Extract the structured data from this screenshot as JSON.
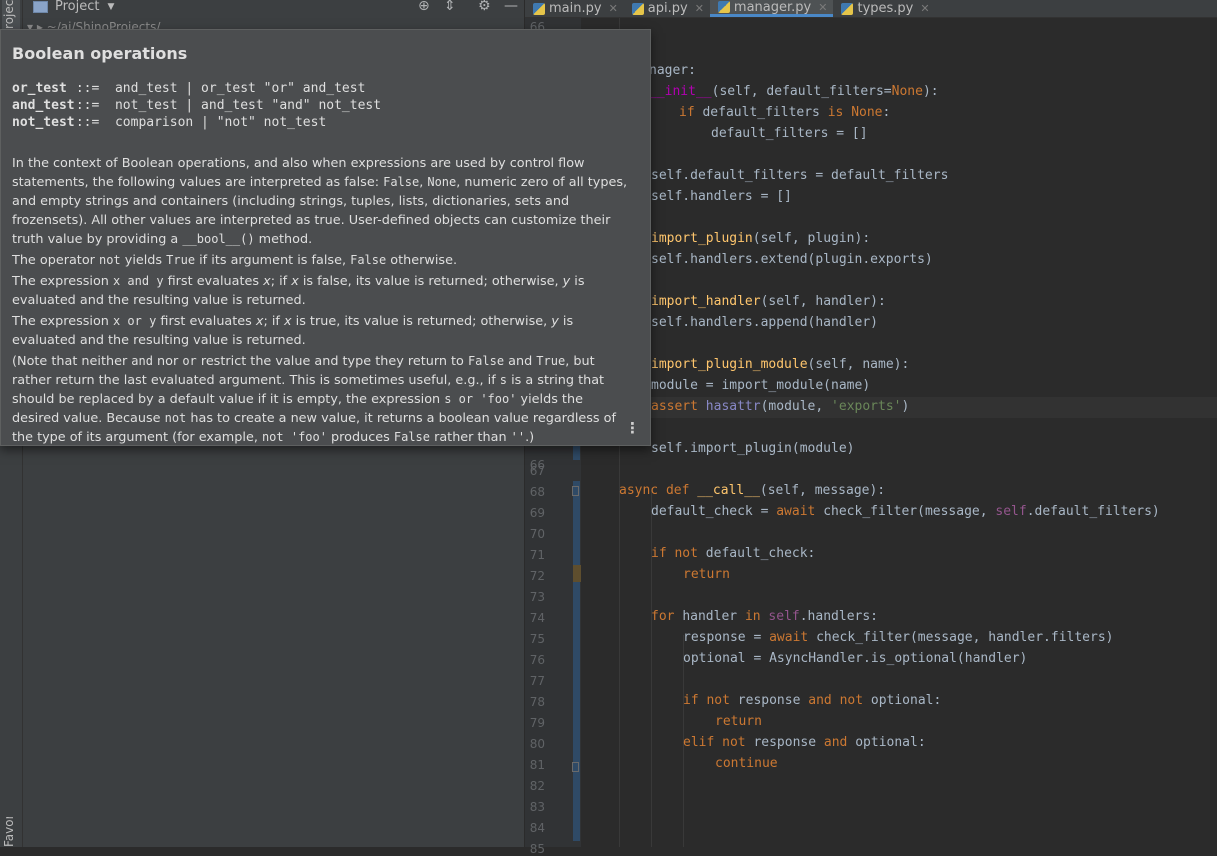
{
  "left_strip": {
    "project_tab": "Project",
    "favorites_tab": "Favorites"
  },
  "project_panel": {
    "title": "Project",
    "tree_row_text": "▾ ▸  ~/ai/ShinoProjects/..."
  },
  "editor_tabs": [
    {
      "label": "main.py",
      "active": false
    },
    {
      "label": "api.py",
      "active": false
    },
    {
      "label": "manager.py",
      "active": true
    },
    {
      "label": "types.py",
      "active": false
    }
  ],
  "gutter": {
    "line_numbers": [
      "66",
      "67",
      "68",
      "69",
      "70",
      "71",
      "72",
      "73",
      "74",
      "75",
      "76",
      "77",
      "78",
      "79",
      "80",
      "81",
      "82",
      "83",
      "84",
      "85"
    ]
  },
  "code_visible_fragments": {
    "l1": "nager:",
    "l2_a": "__init__",
    "l2_b": "(self, default_filters=",
    "l2_c": "None",
    "l2_d": "):",
    "l3_a": "if ",
    "l3_b": "default_filters ",
    "l3_c": "is ",
    "l3_d": "None",
    "l3_e": ":",
    "l4": "default_filters = []",
    "l6": "self.default_filters = default_filters",
    "l7": "self.handlers = []",
    "l9_a": "import_plugin",
    "l9_b": "(self, plugin):",
    "l10": "self.handlers.extend(plugin.exports)",
    "l12_a": "import_handler",
    "l12_b": "(self, handler):",
    "l13": "self.handlers.append(handler)",
    "l15_a": "import_plugin_module",
    "l15_b": "(self, name):",
    "l16": "module = import_module(name)",
    "l17_a": "assert ",
    "l17_b": "hasattr",
    "l17_c": "(module, ",
    "l17_d": "'exports'",
    "l17_e": ")",
    "l19": "self.import_plugin(module)"
  },
  "code": {
    "l68": {
      "a": "async ",
      "b": "def ",
      "c": "__call__",
      "d": "(self, message):"
    },
    "l69": {
      "a": "default_check = ",
      "b": "await ",
      "c": "check_filter(message, ",
      "d": "self",
      ".e": "",
      "e": ".default_filters)"
    },
    "l71": {
      "a": "if ",
      "b": "not ",
      "c": "default_check:"
    },
    "l72": {
      "a": "return"
    },
    "l74": {
      "a": "for ",
      "b": "handler ",
      "c": "in ",
      "d": "self",
      "e": ".handlers:"
    },
    "l75": {
      "a": "response = ",
      "b": "await ",
      "c": "check_filter(message, handler.filters)"
    },
    "l76": {
      "a": "optional = AsyncHandler.is_optional(handler)"
    },
    "l78": {
      "a": "if ",
      "b": "not ",
      "c": "response ",
      "d": "and ",
      "e": "not ",
      "f": "optional:"
    },
    "l79": {
      "a": "return"
    },
    "l80": {
      "a": "elif ",
      "b": "not ",
      "c": "response ",
      "d": "and ",
      "e": "optional:"
    },
    "l81": {
      "a": "continue"
    }
  },
  "doc_popup": {
    "title": "Boolean operations",
    "grammar": [
      {
        "name": "or_test",
        "def": "::=  and_test | or_test \"or\" and_test"
      },
      {
        "name": "and_test",
        "def": "::=  not_test | and_test \"and\" not_test"
      },
      {
        "name": "not_test",
        "def": "::=  comparison | \"not\" not_test"
      }
    ],
    "p1_a": "In the context of Boolean operations, and also when expressions are used by control flow statements, the following values are interpreted as false: ",
    "p1_false": "False",
    "p1_sep1": ", ",
    "p1_none": "None",
    "p1_b": ", numeric zero of all types, and empty strings and containers (including strings, tuples, lists, dictionaries, sets and frozensets). All other values are interpreted as true. User-defined objects can customize their truth value by providing a ",
    "p1_bool": "__bool__()",
    "p1_c": " method.",
    "p2_a": "The operator ",
    "p2_not": "not",
    "p2_b": " yields ",
    "p2_true": "True",
    "p2_c": " if its argument is false, ",
    "p2_false": "False",
    "p2_d": " otherwise.",
    "p3_a": "The expression ",
    "p3_expr": "x and y",
    "p3_b": " first evaluates ",
    "p3_x1": "x",
    "p3_c": "; if ",
    "p3_x2": "x",
    "p3_d": " is false, its value is returned; otherwise, ",
    "p3_y": "y",
    "p3_e": " is evaluated and the resulting value is returned.",
    "p4_a": "The expression ",
    "p4_expr": "x or y",
    "p4_b": " first evaluates ",
    "p4_x1": "x",
    "p4_c": "; if ",
    "p4_x2": "x",
    "p4_d": " is true, its value is returned; otherwise, ",
    "p4_y": "y",
    "p4_e": " is evaluated and the resulting value is returned.",
    "p5_a": "(Note that neither ",
    "p5_and": "and",
    "p5_b": " nor ",
    "p5_or": "or",
    "p5_c": " restrict the value and type they return to ",
    "p5_false": "False",
    "p5_d": " and ",
    "p5_true": "True",
    "p5_e": ", but rather return the last evaluated argument. This is sometimes useful, e.g., if ",
    "p5_s": "s",
    "p5_f": " is a string that should be replaced by a default value if it is empty, the expression ",
    "p5_expr": "s or 'foo'",
    "p5_g": " yields the desired value. Because ",
    "p5_not": "not",
    "p5_h": " has to create a new value, it returns a boolean value regardless of the type of its argument (for example, ",
    "p5_notfoo": "not 'foo'",
    "p5_i": " produces ",
    "p5_false2": "False",
    "p5_j": " rather than ",
    "p5_empty": "''",
    "p5_k": ".)",
    "more_icon": "⋮"
  },
  "colors": {
    "editor_bg": "#2b2b2b",
    "popup_bg": "#4b4d4f",
    "keyword": "#cc7832",
    "self": "#94558d",
    "function": "#ffc66d",
    "string": "#6a8759",
    "active_tab_underline": "#4a88c7"
  }
}
